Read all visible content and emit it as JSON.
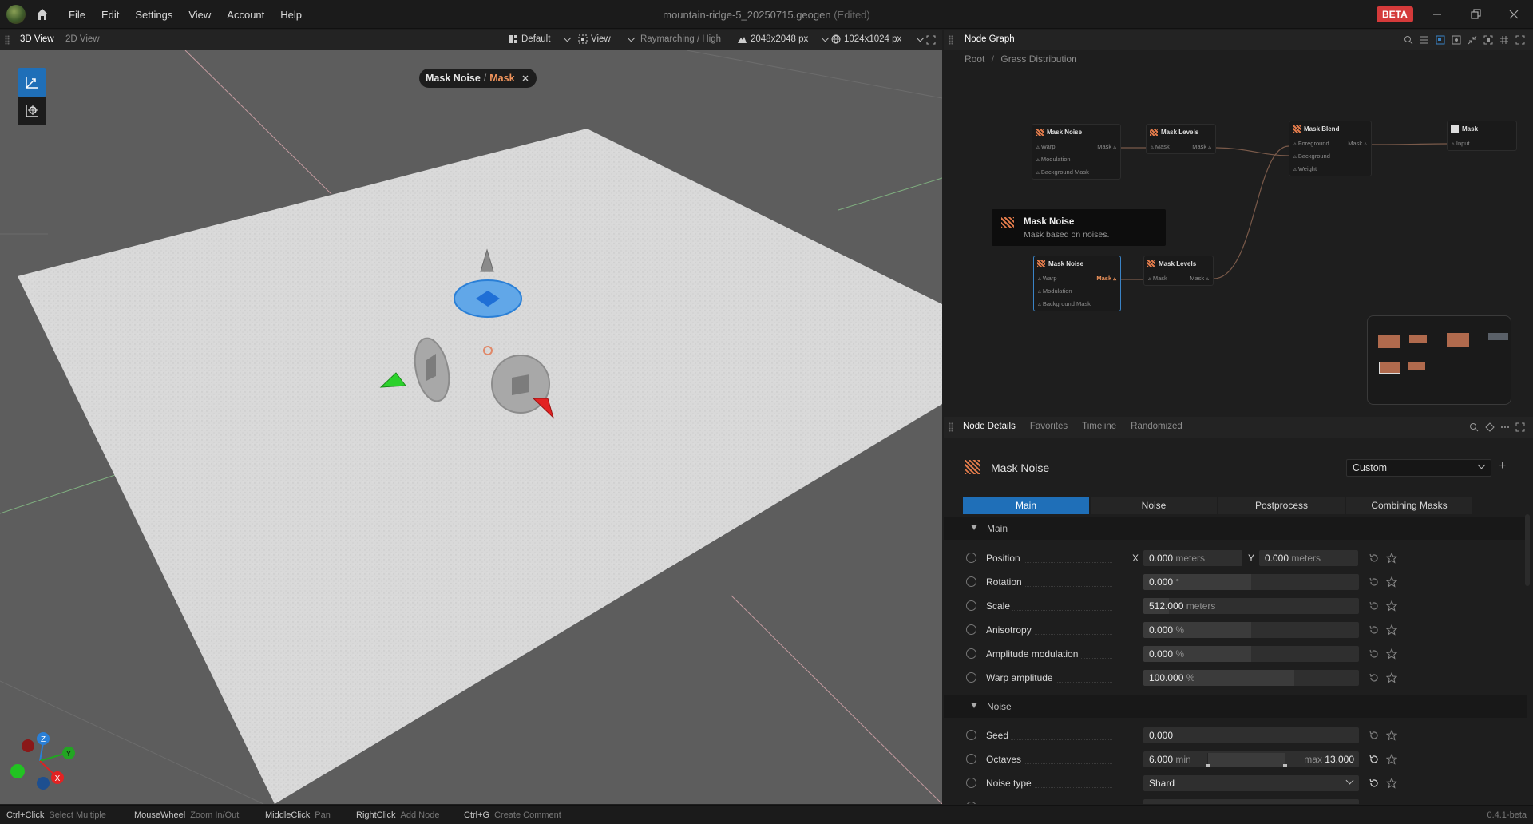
{
  "menubar": {
    "items": [
      "File",
      "Edit",
      "Settings",
      "View",
      "Account",
      "Help"
    ],
    "document_title": "mountain-ridge-5_20250715.geogen",
    "edited_flag": "(Edited)",
    "beta_badge": "BETA"
  },
  "viewport_toolbar": {
    "tabs": [
      "3D View",
      "2D View"
    ],
    "active_tab": "3D View",
    "layout": "Default",
    "view": "View",
    "render_mode": "Raymarching / High",
    "resolution": "2048x2048 px",
    "preview_resolution": "1024x1024 px"
  },
  "viewport": {
    "breadcrumb": {
      "node": "Mask Noise",
      "separator": "/",
      "output": "Mask"
    },
    "gizmo_axes": [
      "Z",
      "Y",
      "X"
    ],
    "colors": {
      "terrain": "#d8d8d8",
      "background": "#5d5d5d",
      "x_axis": "#e32222",
      "y_axis": "#22c322",
      "z_axis": "#2a7fd6",
      "selection": "#1f6fb8"
    }
  },
  "node_graph": {
    "panel_title": "Node Graph",
    "breadcrumb": [
      "Root",
      "/",
      "Grass Distribution"
    ],
    "nodes": [
      {
        "title": "Mask Noise",
        "inputs": [
          "Warp",
          "Modulation",
          "Background Mask"
        ],
        "output": "Mask"
      },
      {
        "title": "Mask Levels",
        "inputs": [
          "Mask"
        ],
        "output": "Mask"
      },
      {
        "title": "Mask Blend",
        "inputs": [
          "Foreground",
          "Background",
          "Weight"
        ],
        "output": "Mask"
      },
      {
        "title": "Mask",
        "inputs": [
          "Input"
        ],
        "output": ""
      },
      {
        "title": "Mask Noise",
        "inputs": [
          "Warp",
          "Modulation",
          "Background Mask"
        ],
        "output": "Mask"
      },
      {
        "title": "Mask Levels",
        "inputs": [
          "Mask"
        ],
        "output": "Mask"
      }
    ],
    "tooltip": {
      "title": "Mask Noise",
      "description": "Mask based on noises."
    }
  },
  "node_details": {
    "tabs": [
      "Node Details",
      "Favorites",
      "Timeline",
      "Randomized"
    ],
    "active_tab": "Node Details",
    "node_title": "Mask Noise",
    "preset": "Custom",
    "subtabs": [
      "Main",
      "Noise",
      "Postprocess",
      "Combining Masks"
    ],
    "active_subtab": "Main",
    "sections": [
      {
        "title": "Main",
        "params": [
          {
            "label": "Position",
            "x_axis": "X",
            "x_value": "0.000",
            "x_unit": "meters",
            "y_axis": "Y",
            "y_value": "0.000",
            "y_unit": "meters"
          },
          {
            "label": "Rotation",
            "value": "0.000",
            "unit": "°",
            "fill": 0.5
          },
          {
            "label": "Scale",
            "value": "512.000",
            "unit": "meters",
            "fill": 0.12
          },
          {
            "label": "Anisotropy",
            "value": "0.000",
            "unit": "%",
            "fill": 0.5
          },
          {
            "label": "Amplitude modulation",
            "value": "0.000",
            "unit": "%",
            "fill": 0.5
          },
          {
            "label": "Warp amplitude",
            "value": "100.000",
            "unit": "%",
            "fill": 0.7
          }
        ]
      },
      {
        "title": "Noise",
        "params": [
          {
            "label": "Seed",
            "value": "0.000",
            "unit": ""
          },
          {
            "label": "Octaves",
            "min_label": "min",
            "min_value": "6.000",
            "max_label": "max",
            "max_value": "13.000"
          },
          {
            "label": "Noise type",
            "value": "Shard"
          }
        ]
      }
    ]
  },
  "statusbar": {
    "hints": [
      {
        "key": "Ctrl+Click",
        "desc": "Select Multiple"
      },
      {
        "key": "MouseWheel",
        "desc": "Zoom In/Out"
      },
      {
        "key": "MiddleClick",
        "desc": "Pan"
      },
      {
        "key": "RightClick",
        "desc": "Add Node"
      },
      {
        "key": "Ctrl+G",
        "desc": "Create Comment"
      }
    ],
    "version": "0.4.1-beta"
  }
}
